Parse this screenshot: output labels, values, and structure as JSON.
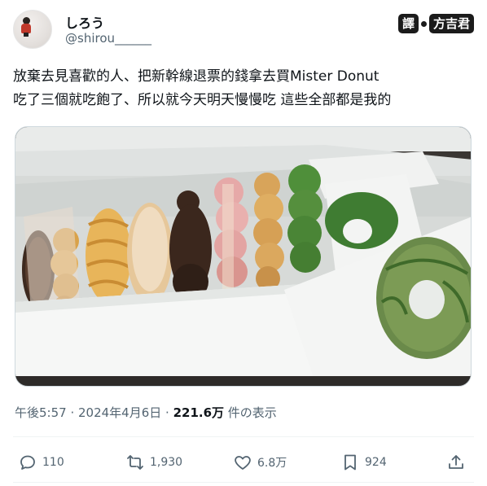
{
  "author": {
    "name": "しろう",
    "handle": "@shirou______"
  },
  "watermark": {
    "left": "譯",
    "right": "方吉君"
  },
  "tweet": {
    "line1": "放棄去見喜歡的人、把新幹線退票的錢拿去買Mister Donut",
    "line2": "吃了三個就吃飽了、所以就今天明天慢慢吃 這些全部都是我的"
  },
  "meta": {
    "time": "午後5:57",
    "sep1": " · ",
    "date": "2024年4月6日",
    "sep2": " · ",
    "views": "221.6万",
    "views_label": " 件の表示"
  },
  "actions": {
    "replies": "110",
    "reposts": "1,930",
    "likes": "6.8万",
    "bookmarks": "924"
  },
  "icons": [
    "reply-icon",
    "repost-icon",
    "like-icon",
    "bookmark-icon",
    "share-icon"
  ],
  "colors": {
    "secondary_text": "#536471",
    "divider": "#eff3f4",
    "primary_text": "#0f1419"
  }
}
